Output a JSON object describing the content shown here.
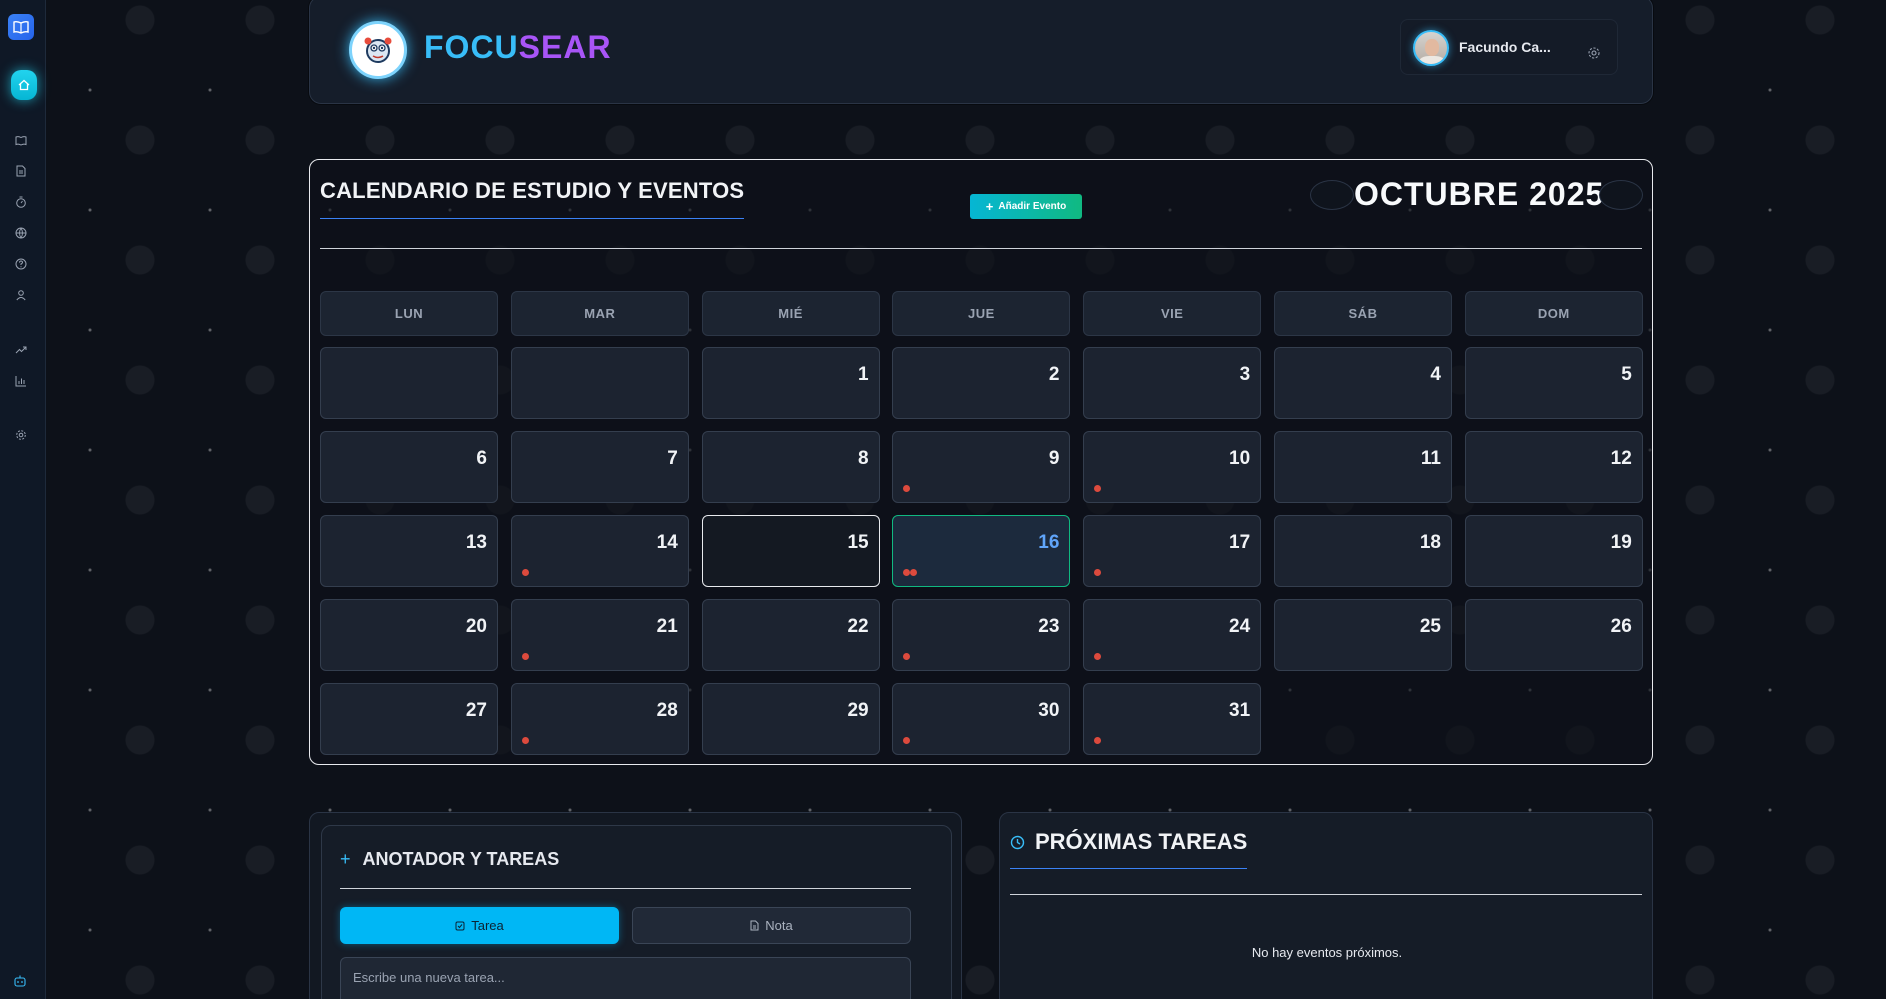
{
  "brand": {
    "part1": "FOCU",
    "part2": "SEAR"
  },
  "user": {
    "name": "Facundo Ca..."
  },
  "calendar": {
    "title": "CALENDARIO DE ESTUDIO Y EVENTOS",
    "add_label": "Añadir Evento",
    "month": "OCTUBRE 2025",
    "days_of_week": [
      "LUN",
      "MAR",
      "MIÉ",
      "JUE",
      "VIE",
      "SÁB",
      "DOM"
    ],
    "days": [
      {
        "n": "1",
        "dots": 0
      },
      {
        "n": "2",
        "dots": 0
      },
      {
        "n": "3",
        "dots": 0
      },
      {
        "n": "4",
        "dots": 0
      },
      {
        "n": "5",
        "dots": 0
      },
      {
        "n": "6",
        "dots": 0
      },
      {
        "n": "7",
        "dots": 0
      },
      {
        "n": "8",
        "dots": 0
      },
      {
        "n": "9",
        "dots": 1
      },
      {
        "n": "10",
        "dots": 1
      },
      {
        "n": "11",
        "dots": 0
      },
      {
        "n": "12",
        "dots": 0
      },
      {
        "n": "13",
        "dots": 0
      },
      {
        "n": "14",
        "dots": 1
      },
      {
        "n": "15",
        "dots": 0,
        "state": "today"
      },
      {
        "n": "16",
        "dots": 2,
        "state": "selected"
      },
      {
        "n": "17",
        "dots": 1
      },
      {
        "n": "18",
        "dots": 0
      },
      {
        "n": "19",
        "dots": 0
      },
      {
        "n": "20",
        "dots": 0
      },
      {
        "n": "21",
        "dots": 1
      },
      {
        "n": "22",
        "dots": 0
      },
      {
        "n": "23",
        "dots": 1
      },
      {
        "n": "24",
        "dots": 1
      },
      {
        "n": "25",
        "dots": 0
      },
      {
        "n": "26",
        "dots": 0
      },
      {
        "n": "27",
        "dots": 0
      },
      {
        "n": "28",
        "dots": 1
      },
      {
        "n": "29",
        "dots": 0
      },
      {
        "n": "30",
        "dots": 1
      },
      {
        "n": "31",
        "dots": 1
      }
    ],
    "dot_color": "#dc4a3d",
    "accent": "#10b981"
  },
  "notes": {
    "title": "ANOTADOR Y TAREAS",
    "tab_task": "Tarea",
    "tab_note": "Nota",
    "placeholder": "Escribe una nueva tarea..."
  },
  "upcoming": {
    "title": "PRÓXIMAS TAREAS",
    "empty": "No hay eventos próximos."
  },
  "sidebar_icons": [
    "book-icon",
    "home-icon",
    "open-book-icon",
    "document-icon",
    "timer-icon",
    "globe-icon",
    "help-icon",
    "user-icon",
    "trending-up-icon",
    "bar-chart-icon",
    "settings-icon",
    "bot-icon"
  ]
}
